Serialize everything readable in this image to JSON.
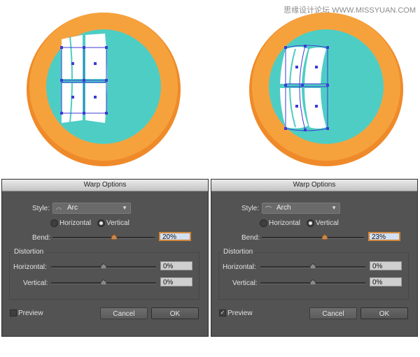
{
  "watermark": "思缘设计论坛 WWW.MISSYUAN.COM",
  "colors": {
    "outer_ring": "#f39a35",
    "ring_shadow": "#e8882a",
    "inner_face": "#4ecdc4",
    "graphic": "#ffffff",
    "selection": "#3b3bd6",
    "dialog_bg": "#535353",
    "focus": "#d2873d"
  },
  "dialogs": [
    {
      "title": "Warp Options",
      "style_label": "Style:",
      "style_icon": "arc-icon",
      "style_value": "Arc",
      "horizontal_label": "Horizontal",
      "vertical_label": "Vertical",
      "orientation": "Vertical",
      "bend_label": "Bend:",
      "bend_value": "20%",
      "bend_fraction": 0.6,
      "distortion_label": "Distortion",
      "h_label": "Horizontal:",
      "h_value": "0%",
      "v_label": "Vertical:",
      "v_value": "0%",
      "preview_label": "Preview",
      "preview_checked": false,
      "preview_mark": "",
      "cancel_label": "Cancel",
      "ok_label": "OK"
    },
    {
      "title": "Warp Options",
      "style_label": "Style:",
      "style_icon": "arch-icon",
      "style_value": "Arch",
      "horizontal_label": "Horizontal",
      "vertical_label": "Vertical",
      "orientation": "Vertical",
      "bend_label": "Bend:",
      "bend_value": "23%",
      "bend_fraction": 0.615,
      "distortion_label": "Distortion",
      "h_label": "Horizontal:",
      "h_value": "0%",
      "v_label": "Vertical:",
      "v_value": "0%",
      "preview_label": "Preview",
      "preview_checked": true,
      "preview_mark": "✓",
      "cancel_label": "Cancel",
      "ok_label": "OK"
    }
  ]
}
